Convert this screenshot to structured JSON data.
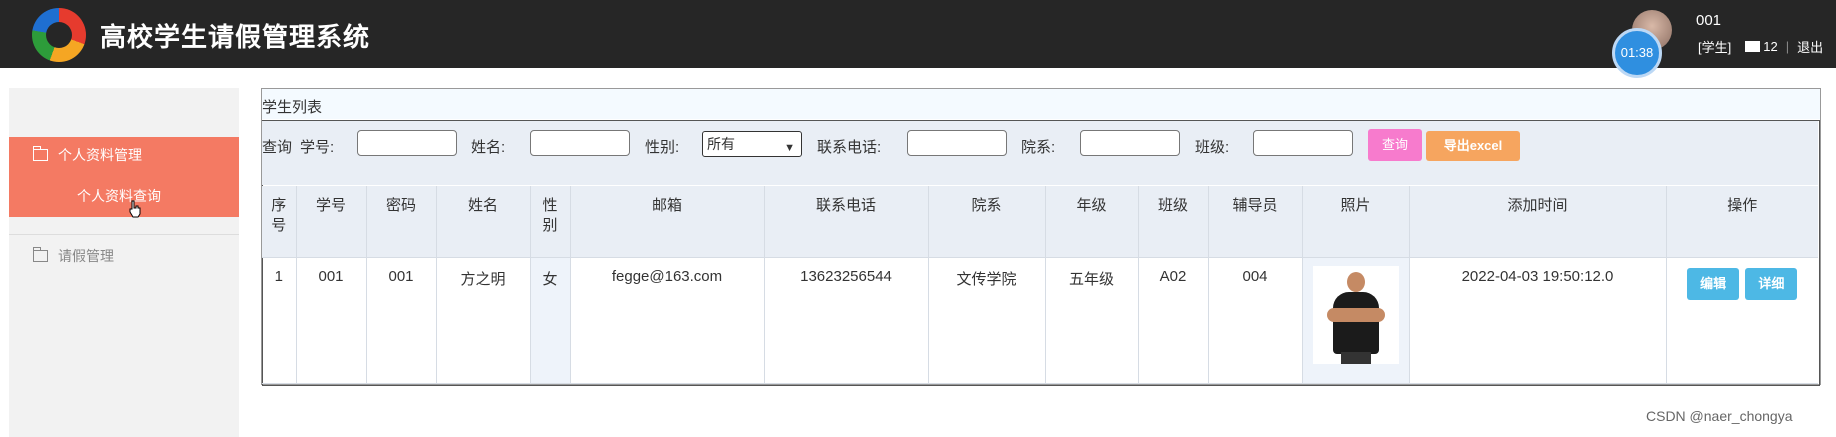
{
  "header": {
    "title": "高校学生请假管理系统",
    "clock": "01:38",
    "user_id": "001",
    "role": "[学生]",
    "mail_count": "12",
    "logout": "退出"
  },
  "sidebar": {
    "groups": [
      {
        "label": "个人资料管理",
        "items": [
          {
            "label": "个人资料查询"
          }
        ]
      },
      {
        "label": "请假管理",
        "items": []
      }
    ]
  },
  "panel": {
    "title": "学生列表"
  },
  "search": {
    "query_prefix": "查询",
    "student_no_label": "学号:",
    "name_label": "姓名:",
    "gender_label": "性别:",
    "gender_selected": "所有",
    "phone_label": "联系电话:",
    "dept_label": "院系:",
    "class_label": "班级:",
    "query_button": "查询",
    "export_button": "导出excel"
  },
  "table": {
    "columns": [
      "序号",
      "学号",
      "密码",
      "姓名",
      "性别",
      "邮箱",
      "联系电话",
      "院系",
      "年级",
      "班级",
      "辅导员",
      "照片",
      "添加时间",
      "操作"
    ],
    "rows": [
      {
        "index": "1",
        "student_no": "001",
        "password": "001",
        "name": "方之明",
        "gender": "女",
        "email": "fegge@163.com",
        "phone": "13623256544",
        "dept": "文传学院",
        "grade": "五年级",
        "class": "A02",
        "counselor": "004",
        "added_time": "2022-04-03 19:50:12.0",
        "edit_label": "编辑",
        "detail_label": "详细"
      }
    ]
  },
  "watermark": "CSDN @naer_chongya",
  "colors": {
    "header_bg": "#262626",
    "menu_active": "#f47a63",
    "btn_query": "#f77bcd",
    "btn_export": "#f6a55f",
    "btn_op": "#4db8e5"
  }
}
